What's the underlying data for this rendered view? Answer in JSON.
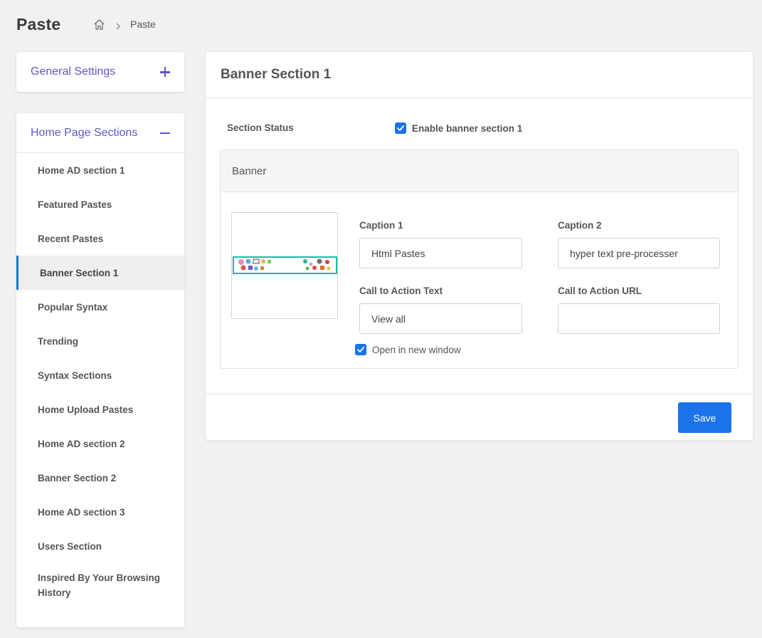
{
  "header": {
    "title": "Paste",
    "breadcrumb": {
      "home_icon": "home-icon",
      "separator_icon": "chevron-right-icon",
      "current": "Paste"
    }
  },
  "sidebar": {
    "general_settings": {
      "title": "General Settings",
      "toggle_icon": "plus-icon"
    },
    "home_page_sections": {
      "title": "Home Page Sections",
      "toggle_icon": "minus-icon",
      "items": [
        {
          "label": "Home AD section 1",
          "active": false
        },
        {
          "label": "Featured Pastes",
          "active": false
        },
        {
          "label": "Recent Pastes",
          "active": false
        },
        {
          "label": "Banner Section 1",
          "active": true
        },
        {
          "label": "Popular Syntax",
          "active": false
        },
        {
          "label": "Trending",
          "active": false
        },
        {
          "label": "Syntax Sections",
          "active": false
        },
        {
          "label": "Home Upload Pastes",
          "active": false
        },
        {
          "label": "Home AD section 2",
          "active": false
        },
        {
          "label": "Banner Section 2",
          "active": false
        },
        {
          "label": "Home AD section 3",
          "active": false
        },
        {
          "label": "Users Section",
          "active": false
        },
        {
          "label": "Inspired By Your Browsing History",
          "active": false
        }
      ]
    }
  },
  "main": {
    "title": "Banner Section 1",
    "section_status": {
      "label": "Section Status",
      "checkbox_label": "Enable banner section 1",
      "checked": true
    },
    "banner": {
      "heading": "Banner",
      "caption1": {
        "label": "Caption 1",
        "value": "Html Pastes"
      },
      "caption2": {
        "label": "Caption 2",
        "value": "hyper text pre-processer"
      },
      "cta_text": {
        "label": "Call to Action Text",
        "value": "View all"
      },
      "cta_url": {
        "label": "Call to Action URL",
        "value": ""
      },
      "new_window": {
        "label": "Open in new window",
        "checked": true
      }
    },
    "save_label": "Save"
  },
  "colors": {
    "accent": "#1a73e8",
    "sidebar_header": "#6056c8",
    "banner_border": "#1eb9a6",
    "background": "#f1f1f1"
  }
}
